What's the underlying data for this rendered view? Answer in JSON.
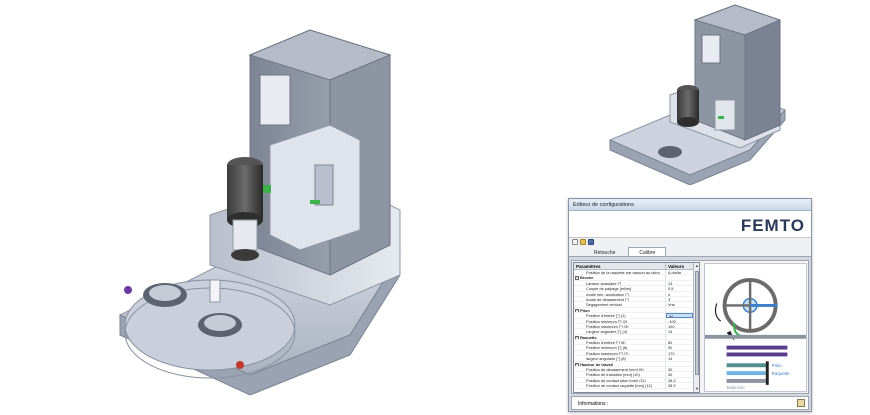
{
  "window": {
    "title": "Editeur de configurations",
    "logo": "FEMTO",
    "tabs": [
      {
        "label": "Retouche",
        "active": false
      },
      {
        "label": "Calibre",
        "active": true
      }
    ],
    "columns": {
      "param": "Paramètres",
      "value": "Valeurs"
    },
    "rows": [
      {
        "type": "item",
        "label": "Position de la raquette par rapport au piton",
        "value": "A droite"
      },
      {
        "type": "group",
        "label": "Broche"
      },
      {
        "type": "item",
        "label": "Largeur angulaire [°]",
        "value": "13"
      },
      {
        "type": "item",
        "label": "Couple de palpage [mNm]",
        "value": "0.5"
      },
      {
        "type": "item",
        "label": "Angle min. application [°]",
        "value": "4"
      },
      {
        "type": "item",
        "label": "Angle de dégagement [°]",
        "value": "3"
      },
      {
        "type": "item",
        "label": "Dégagement vertical",
        "value": "Vrai"
      },
      {
        "type": "group",
        "label": "Piton"
      },
      {
        "type": "item",
        "label": "Position d'entrée [°] (1)",
        "value": "80",
        "selected": true
      },
      {
        "type": "item",
        "label": "Position minimum [°] (2)",
        "value": "-100"
      },
      {
        "type": "item",
        "label": "Position maximum [°] (3)",
        "value": "100"
      },
      {
        "type": "item",
        "label": "Largeur angulaire [°] (4)",
        "value": "14"
      },
      {
        "type": "group",
        "label": "Raquette"
      },
      {
        "type": "item",
        "label": "Position d'entrée [°] (5)",
        "value": "80"
      },
      {
        "type": "item",
        "label": "Position minimum [°] (6)",
        "value": "90"
      },
      {
        "type": "item",
        "label": "Position maximum [°] (7)",
        "value": "170"
      },
      {
        "type": "item",
        "label": "largeur angulaire [°] (8)",
        "value": "14"
      },
      {
        "type": "group",
        "label": "Hauteur de travail"
      },
      {
        "type": "item",
        "label": "Position de dégagement [mm] (9)",
        "value": "30"
      },
      {
        "type": "item",
        "label": "Position de transition [mm] (10)",
        "value": "30"
      },
      {
        "type": "item",
        "label": "Position de contact piton [mm] (11)",
        "value": "28.3"
      },
      {
        "type": "item",
        "label": "Position de contact raquette [mm] (12)",
        "value": "28.3"
      }
    ],
    "preview_labels": {
      "piton": "Piton",
      "raquette": "Raquette",
      "balancier": "Balancier"
    },
    "status_label": "Informations :",
    "colors": {
      "accent_purple": "#5b3d8f",
      "accent_teal": "#4f8f8f",
      "accent_blue": "#6fb5e0",
      "logo_dark": "#2a3b57",
      "logo_blue": "#3d7fc4"
    }
  }
}
